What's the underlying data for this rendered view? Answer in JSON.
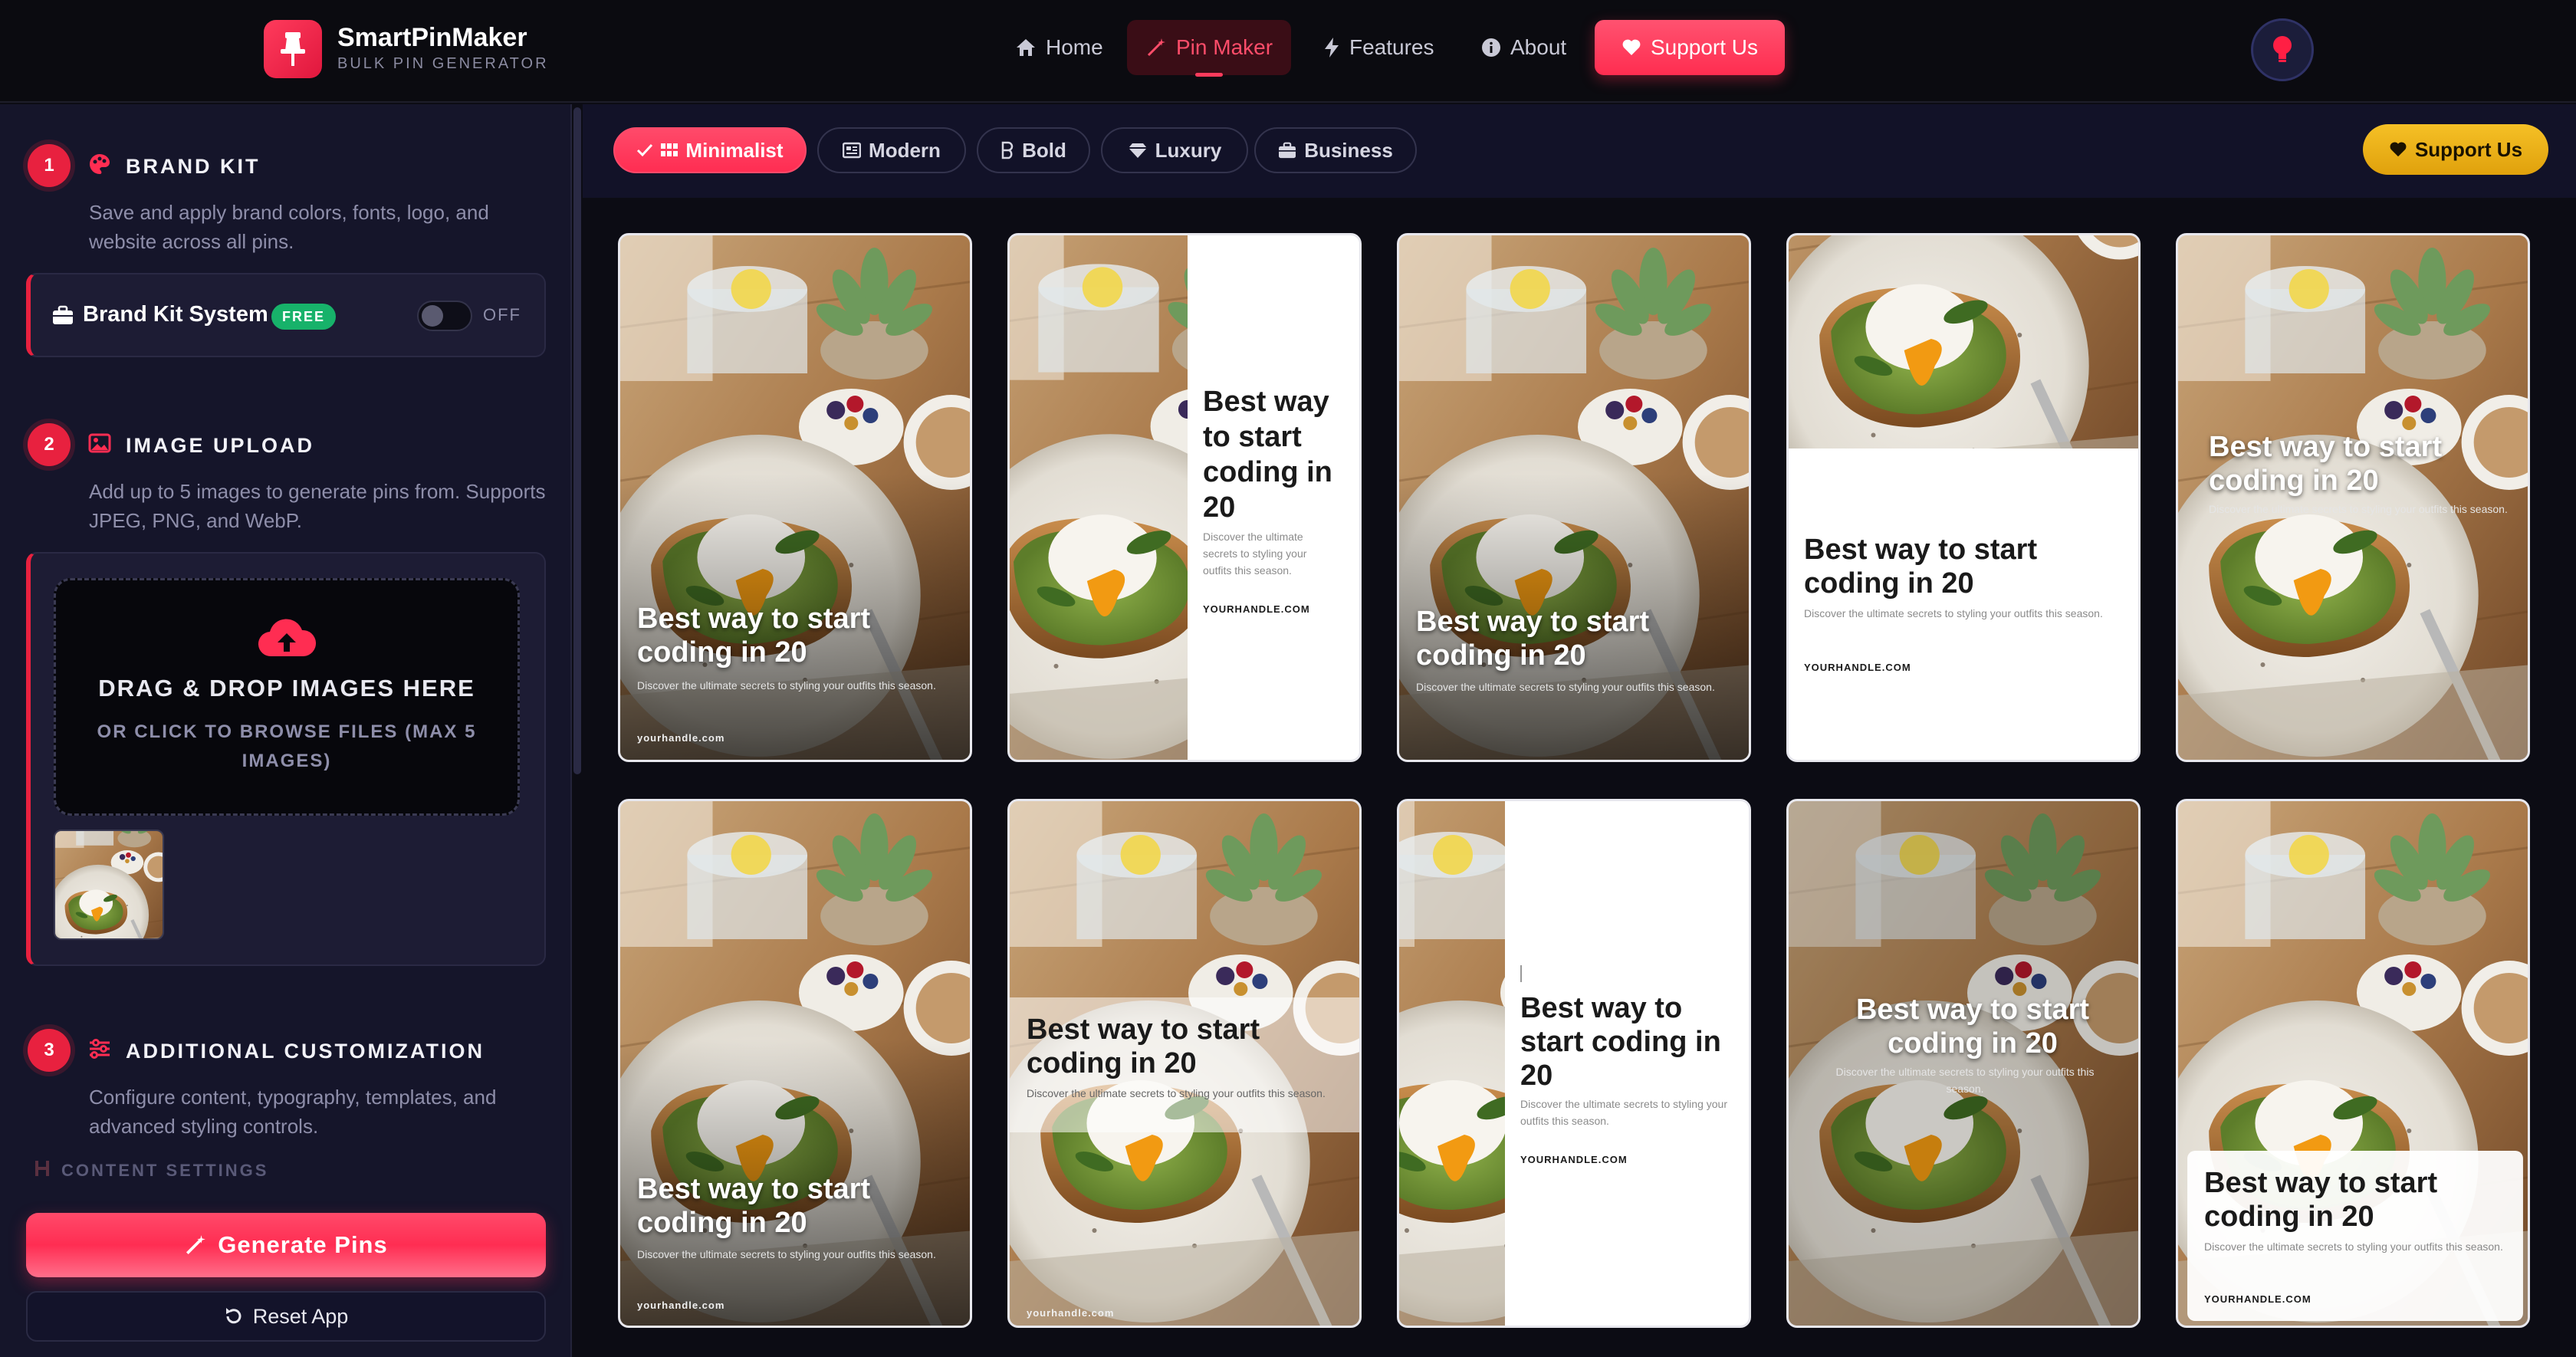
{
  "header": {
    "app_name": "SmartPinMaker",
    "app_tagline": "BULK PIN GENERATOR",
    "nav": [
      {
        "label": "Home",
        "icon": "home-icon"
      },
      {
        "label": "Pin Maker",
        "icon": "magic-wand-icon",
        "active": true
      },
      {
        "label": "Features",
        "icon": "bolt-icon"
      },
      {
        "label": "About",
        "icon": "info-icon"
      }
    ],
    "support_label": "Support Us"
  },
  "sidebar": {
    "brand_kit": {
      "step": "1",
      "title": "BRAND KIT",
      "description": "Save and apply brand colors, fonts, logo, and website across all pins.",
      "system_label": "Brand Kit System",
      "badge": "FREE",
      "toggle_state": "OFF"
    },
    "image_upload": {
      "step": "2",
      "title": "IMAGE UPLOAD",
      "description": "Add up to 5 images to generate pins from. Supports JPEG, PNG, and WebP.",
      "drop_title": "DRAG & DROP IMAGES HERE",
      "drop_sub": "OR CLICK TO BROWSE FILES (MAX 5 IMAGES)"
    },
    "customization": {
      "step": "3",
      "title": "ADDITIONAL CUSTOMIZATION",
      "description": "Configure content, typography, templates, and advanced styling controls.",
      "content_settings": "CONTENT SETTINGS"
    },
    "generate_label": "Generate Pins",
    "reset_label": "Reset App"
  },
  "templates": {
    "tabs": [
      "Minimalist",
      "Modern",
      "Bold",
      "Luxury",
      "Business"
    ],
    "active": "Minimalist",
    "support_label": "Support Us"
  },
  "pin": {
    "title": "Best way to start coding in 20",
    "description": "Discover the ultimate secrets to styling your outfits this season.",
    "handle_upper": "YOURHANDLE.COM",
    "handle_lower": "yourhandle.com"
  },
  "colors": {
    "accent": "#ff2d52",
    "background": "#0c0c14",
    "sidebar": "#15152a",
    "gold": "#f5c026",
    "badge_green": "#17b26a"
  }
}
